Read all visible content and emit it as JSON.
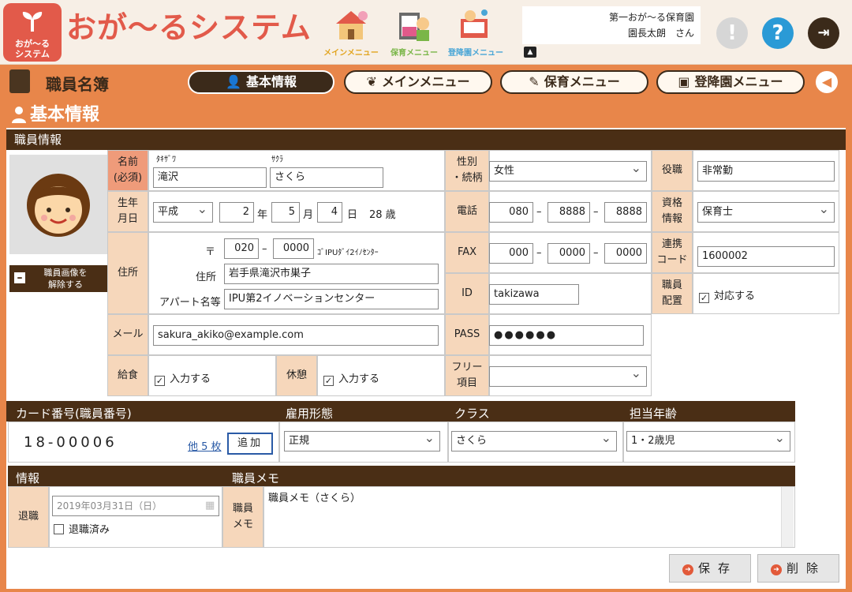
{
  "header": {
    "logo_text": "おが～る\nシステム",
    "app_title": "おが～るシステム",
    "nav_icons": [
      {
        "label": "メインメニュー"
      },
      {
        "label": "保育メニュー"
      },
      {
        "label": "登降園メニュー"
      }
    ],
    "facility_name": "第一おが～る保育園",
    "user_name": "園長太朗　さん"
  },
  "navbar": {
    "page_title": "職員名簿",
    "tabs": [
      {
        "label": "基本情報",
        "active": true
      },
      {
        "label": "メインメニュー",
        "active": false
      },
      {
        "label": "保育メニュー",
        "active": false
      },
      {
        "label": "登降園メニュー",
        "active": false
      }
    ]
  },
  "section": {
    "title": "基本情報",
    "staff_info_label": "職員情報"
  },
  "photo": {
    "unset_label_1": "職員画像を",
    "unset_label_2": "解除する"
  },
  "form": {
    "name_label_1": "名前",
    "name_label_2": "(必須)",
    "kana_last": "ﾀｷｻﾞﾜ",
    "kana_first": "ｻｸﾗ",
    "last_name": "滝沢",
    "first_name": "さくら",
    "birth_label_1": "生年",
    "birth_label_2": "月日",
    "era": "平成",
    "birth_year": "2",
    "year_unit": "年",
    "birth_month": "5",
    "month_unit": "月",
    "birth_day": "4",
    "day_unit": "日",
    "age": "28 歳",
    "address_label": "住所",
    "postal_mark": "〒",
    "postal_1": "020",
    "dash": "–",
    "postal_2": "0000",
    "postal_hint": "ｺﾞIPUﾀﾞｲ2ｲﾉｾﾝﾀｰ",
    "addr_label": "住所",
    "address": "岩手県滝沢市巣子",
    "apt_label": "アパート名等",
    "apartment": "IPU第2イノベーションセンター",
    "mail_label": "メール",
    "email": "sakura_akiko@example.com",
    "meal_label": "給食",
    "meal_value": "入力する",
    "break_label": "休憩",
    "break_value": "入力する",
    "gender_label_1": "性別",
    "gender_label_2": "・続柄",
    "gender": "女性",
    "phone_label": "電話",
    "phone_1": "080",
    "phone_2": "8888",
    "phone_3": "8888",
    "fax_label": "FAX",
    "fax_1": "000",
    "fax_2": "0000",
    "fax_3": "0000",
    "id_label": "ID",
    "id_value": "takizawa",
    "pass_label": "PASS",
    "pass_value": "●●●●●●",
    "free_label_1": "フリー",
    "free_label_2": "項目",
    "position_label": "役職",
    "position": "非常勤",
    "license_label_1": "資格",
    "license_label_2": "情報",
    "license": "保育士",
    "link_code_label_1": "連携",
    "link_code_label_2": "コード",
    "link_code": "1600002",
    "placement_label_1": "職員",
    "placement_label_2": "配置",
    "placement_value": "対応する"
  },
  "card": {
    "card_header": "カード番号(職員番号)",
    "card_number": "18-00006",
    "other_link": "他 5 枚",
    "add_button": "追加",
    "employment_header": "雇用形態",
    "employment": "正規",
    "class_header": "クラス",
    "class": "さくら",
    "age_header": "担当年齢",
    "age_range": "1・2歳児"
  },
  "info": {
    "info_header": "情報",
    "memo_header": "職員メモ",
    "retire_label": "退職",
    "retire_date": "2019年03月31日（日）",
    "retired_check": "退職済み",
    "memo_label_1": "職員",
    "memo_label_2": "メモ",
    "memo_text": "職員メモ（さくら）"
  },
  "actions": {
    "save": "保存",
    "delete": "削除"
  },
  "colors": {
    "accent": "#e8864a",
    "dark": "#4a2e15",
    "label_bg": "#f6d7bb",
    "brand_red": "#e25a4a"
  }
}
